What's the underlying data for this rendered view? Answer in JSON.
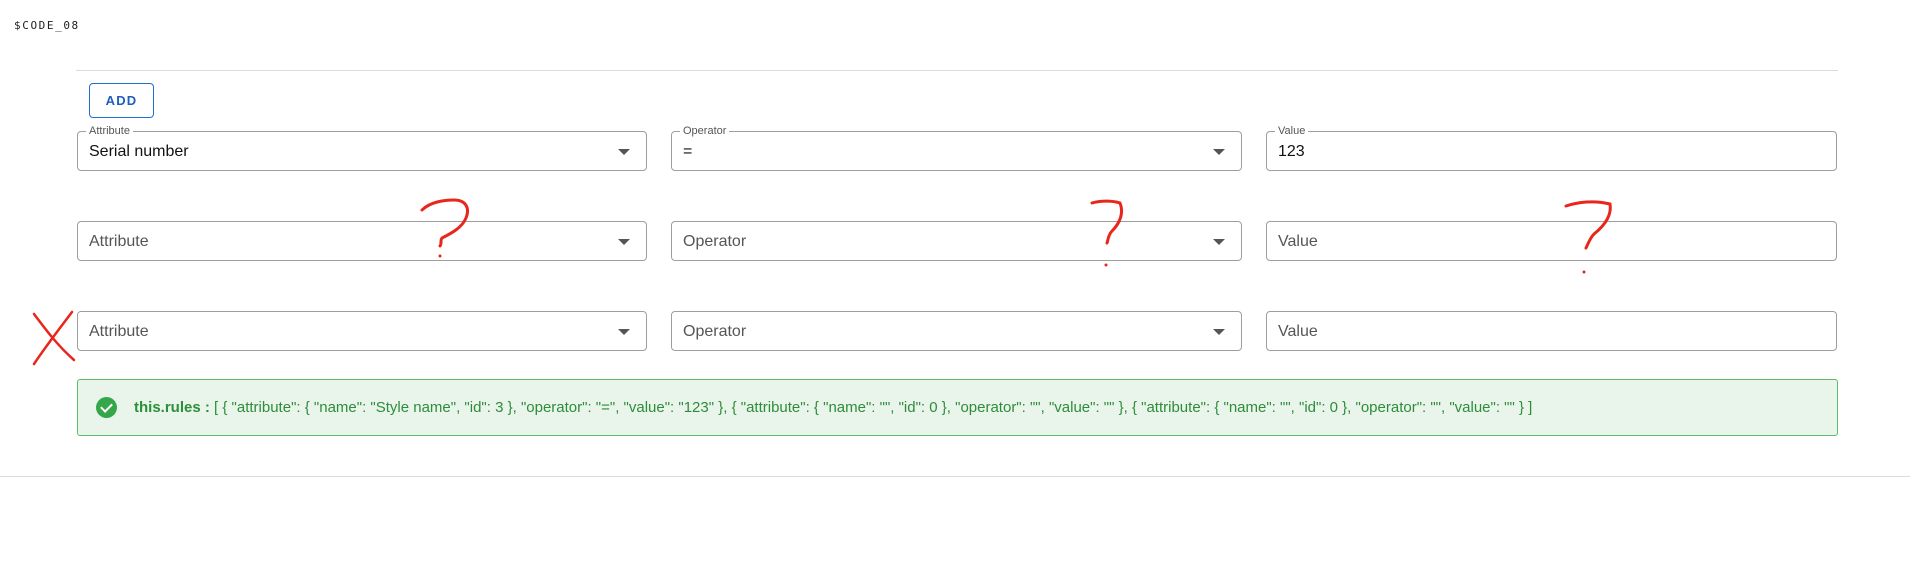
{
  "code_label": "$CODE_08",
  "add_button_label": "ADD",
  "rules": [
    {
      "attribute": {
        "label": "Attribute",
        "value": "Serial number"
      },
      "operator": {
        "label": "Operator",
        "value": "="
      },
      "value": {
        "label": "Value",
        "value": "123"
      }
    },
    {
      "attribute": {
        "placeholder": "Attribute"
      },
      "operator": {
        "placeholder": "Operator"
      },
      "value": {
        "placeholder": "Value"
      }
    },
    {
      "attribute": {
        "placeholder": "Attribute"
      },
      "operator": {
        "placeholder": "Operator"
      },
      "value": {
        "placeholder": "Value"
      }
    }
  ],
  "alert": {
    "key": "this.rules :",
    "text": "[ { \"attribute\": { \"name\": \"Style name\", \"id\": 3 }, \"operator\": \"=\", \"value\": \"123\" }, { \"attribute\": { \"name\": \"\", \"id\": 0 }, \"operator\": \"\", \"value\": \"\" }, { \"attribute\": { \"name\": \"\", \"id\": 0 }, \"operator\": \"\", \"value\": \"\" } ]"
  },
  "colors": {
    "accent": "#1e6fd0",
    "success": "#35a64a",
    "annotation": "#e8261c"
  },
  "icons": {
    "dropdown": "caret-down-icon",
    "success": "check-circle-icon"
  }
}
